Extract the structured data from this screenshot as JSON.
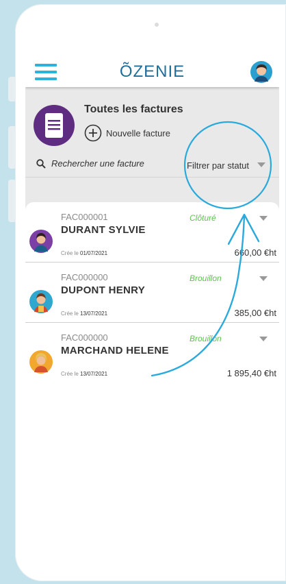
{
  "header": {
    "logo": "ÕZENIE"
  },
  "page": {
    "title": "Toutes les factures",
    "new_invoice_label": "Nouvelle facture",
    "search_placeholder": "Rechercher une facture",
    "filter_label": "Filtrer par statut"
  },
  "invoices": [
    {
      "number": "FAC000001",
      "client": "DURANT SYLVIE",
      "status": "Clôturé",
      "date_prefix": "Crée le",
      "date": "01/07/2021",
      "amount": "660,00 €ht"
    },
    {
      "number": "FAC000000",
      "client": "DUPONT HENRY",
      "status": "Brouillon",
      "date_prefix": "Crée le",
      "date": "13/07/2021",
      "amount": "385,00 €ht"
    },
    {
      "number": "FAC000000",
      "client": "MARCHAND HELENE",
      "status": "Brouillon",
      "date_prefix": "Crée le",
      "date": "13/07/2021",
      "amount": "1 895,40 €ht"
    }
  ],
  "colors": {
    "accent": "#2db3d9",
    "status_green": "#5fc151",
    "logo_blue": "#1f6e99"
  },
  "icons": {
    "menu": "hamburger-menu-icon",
    "search": "search-icon",
    "add": "plus-circle-icon",
    "dropdown": "caret-down-icon",
    "document": "invoice-document-icon"
  }
}
